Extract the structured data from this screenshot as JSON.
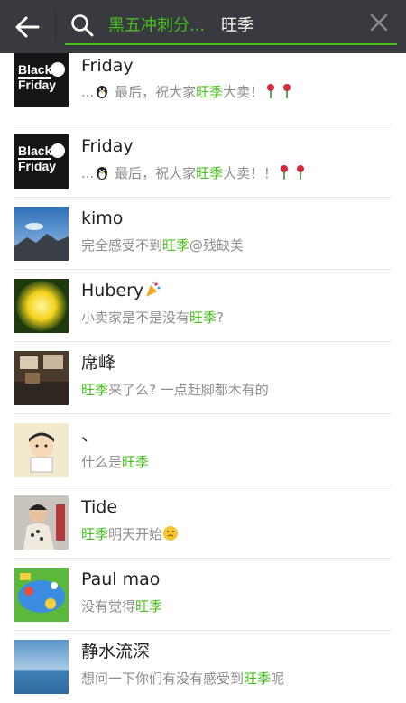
{
  "header": {
    "back_icon": "back-arrow-icon",
    "search_icon": "search-icon",
    "tag": "黑五冲刺分...",
    "query": "旺季",
    "clear_icon": "close-icon"
  },
  "colors": {
    "header_bg": "#393a3f",
    "highlight": "#45c01a"
  },
  "results": [
    {
      "name": "Friday",
      "avatar": "black-friday-logo",
      "snippet": {
        "pre": "...",
        "emoji_a": "penguin-icon",
        "mid": " 最后，祝大家",
        "hl": "旺季",
        "post": "大卖！",
        "emoji_b": "rose-icon"
      }
    },
    {
      "name": "Friday",
      "avatar": "black-friday-logo",
      "snippet": {
        "pre": "...",
        "emoji_a": "penguin-icon",
        "mid": " 最后，祝大家",
        "hl": "旺季",
        "post": "大卖！！",
        "emoji_b": "rose-icon"
      }
    },
    {
      "name": "kimo",
      "avatar": "landscape-photo",
      "snippet": {
        "pre": "完全感受不到",
        "hl": "旺季",
        "post": "@残缺美"
      }
    },
    {
      "name": "Hubery",
      "avatar": "yellow-abstract-image",
      "name_emoji": "party-icon",
      "snippet": {
        "pre": "小卖家是不是没有",
        "hl": "旺季",
        "post": "?"
      }
    },
    {
      "name": "席峰",
      "avatar": "office-photo",
      "snippet": {
        "pre": "",
        "hl": "旺季",
        "post": "来了么? 一点赶脚都木有的"
      }
    },
    {
      "name": "、",
      "avatar": "cartoon-boy-avatar",
      "snippet": {
        "pre": "什么是",
        "hl": "旺季",
        "post": ""
      }
    },
    {
      "name": "Tide",
      "avatar": "person-photo",
      "snippet": {
        "pre": "",
        "hl": "旺季",
        "post": "明天开始",
        "emoji_b": "thinking-face-icon"
      }
    },
    {
      "name": "Paul mao",
      "avatar": "colorful-painting",
      "snippet": {
        "pre": "没有觉得",
        "hl": "旺季",
        "post": ""
      }
    },
    {
      "name": "静水流深",
      "avatar": "sea-photo",
      "snippet": {
        "pre": "想问一下你们有没有感受到",
        "hl": "旺季",
        "post": "呢"
      }
    }
  ]
}
